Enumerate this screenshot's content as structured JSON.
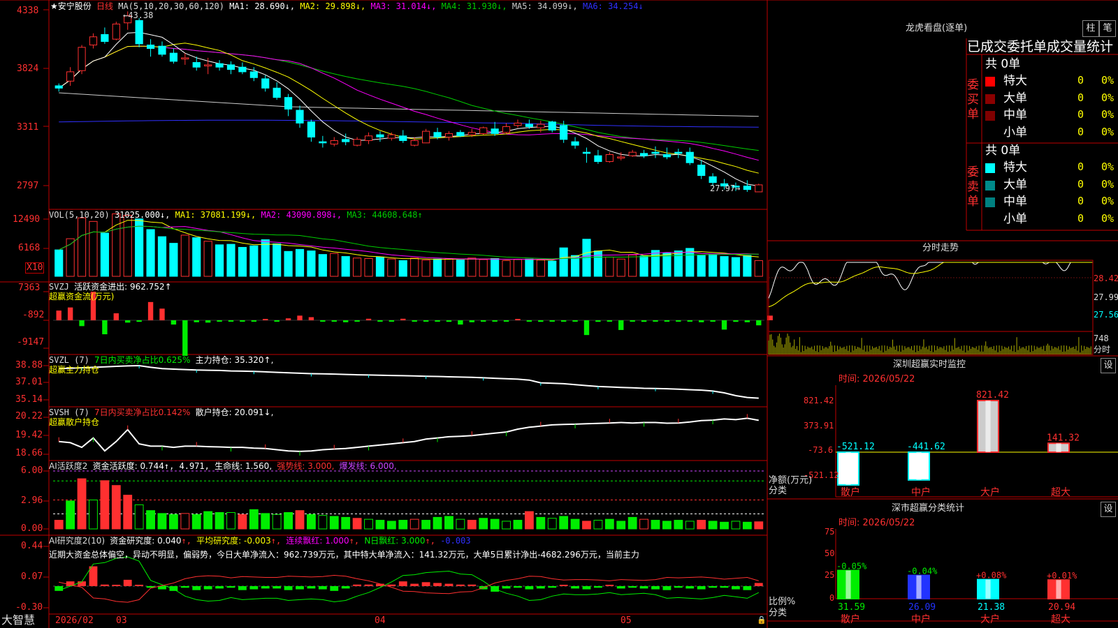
{
  "colors": {
    "up": "#ff3030",
    "down": "#00ffff",
    "frame": "#c00000",
    "axis": "#c00000",
    "ma1": "#ffffff",
    "ma2": "#ffff00",
    "ma3": "#ff00ff",
    "ma4": "#00cc00",
    "ma5": "#cccccc",
    "ma6": "#3030ff",
    "green": "#00ee00",
    "purple": "#cc44ff"
  },
  "price_panel": {
    "stock_name": "★安宁股份",
    "period": "日线",
    "ma_label": "MA(5,10,20,30,60,120)",
    "ma1": "MA1: 28.690↓,",
    "ma2": "MA2: 29.898↓,",
    "ma3": "MA3: 31.014↓,",
    "ma4": "MA4: 31.930↓,",
    "ma5": "MA5: 34.099↓,",
    "ma6": "MA6: 34.254↓",
    "high_marker": "43.38",
    "low_marker": "27.97",
    "y_ticks": [
      "4338",
      "3824",
      "3311",
      "2797"
    ]
  },
  "vol_panel": {
    "label": "VOL(5,10,20)",
    "value": "31025.000↓,",
    "ma1": "MA1: 37081.199↓,",
    "ma2": "MA2: 43090.898↓,",
    "ma3": "MA3: 44608.648↑",
    "y_ticks": [
      "12490",
      "6168"
    ],
    "unit": "X10"
  },
  "svzj_panel": {
    "label": "SVZJ",
    "value": "活跃资金进出: 962.752↑",
    "subtitle": "超赢资金流(万元)",
    "y_ticks": [
      "7363",
      "-892",
      "-9147"
    ]
  },
  "svzl_panel": {
    "label": "SVZL (7)",
    "ratio": "7日内买卖净占比0.625%",
    "hold": "主力持仓: 35.320↑,",
    "subtitle": "超赢主力持仓",
    "y_ticks": [
      "38.88",
      "37.01",
      "35.14"
    ]
  },
  "svsh_panel": {
    "label": "SVSH (7)",
    "ratio": "7日内买卖净占比0.142%",
    "hold": "散户持仓: 20.091↓,",
    "subtitle": "超赢散户持仓",
    "y_ticks": [
      "20.22",
      "19.42",
      "18.66"
    ]
  },
  "ai_act_panel": {
    "label": "AI活跃度2",
    "value": "资金活跃度: 0.744",
    "v2": "↑, 4.971,",
    "life": "生命线: 1.560,",
    "strong": "强势线: 3.000,",
    "burst": "爆发线: 6.000,",
    "y_ticks": [
      "6.00",
      "2.96",
      "0.00"
    ]
  },
  "ai_res_panel": {
    "label": "AI研究度2(10)",
    "value": "资金研究度: 0.040",
    "avg": "平均研究度: -0.003",
    "red": "连续飘红: 1.000",
    "nred": "N日飘红: 3.000",
    "last": "-0.003",
    "comment": "近期大资金总体偏空，异动不明显，偏弱势，今日大单净流入：962.739万元，其中特大单净流入：141.32万元，大单5日累计净出-4682.296万元，当前主力",
    "y_ticks": [
      "0.44",
      "0.07",
      "-0.30"
    ]
  },
  "x_axis": {
    "brand": "大智慧",
    "dates": [
      "2026/02",
      "03",
      "04",
      "05"
    ]
  },
  "right": {
    "dragon_title": "龙虎看盘(逐单)",
    "btn1": "柱",
    "btn2": "笔",
    "orders_title": "已成交委托单成交量统计",
    "buy_label": "委买单",
    "sell_label": "委卖单",
    "buy_total": "共 0单",
    "sell_total": "共 0单",
    "rows": [
      {
        "name": "特大",
        "count": "0",
        "pct": "0%"
      },
      {
        "name": "大单",
        "count": "0",
        "pct": "0%"
      },
      {
        "name": "中单",
        "count": "0",
        "pct": "0%"
      },
      {
        "name": "小单",
        "count": "0",
        "pct": "0%"
      }
    ],
    "buy_colors": [
      "#ff0000",
      "#8b0000",
      "#800000"
    ],
    "sell_colors": [
      "#00ffff",
      "#008b8b",
      "#008080"
    ],
    "minute_title": "分时走势",
    "minute_ticks": [
      "28.42",
      "27.99",
      "27.56"
    ],
    "minute_vol": "748",
    "minute_foot": "分时",
    "sz_title": "深圳超赢实时监控",
    "sz_btn": "设",
    "sz_time": "时间: 2026/05/22",
    "sz_ticks": [
      "821.42",
      "373.91",
      "-73.6",
      "-521.12"
    ],
    "sz_unit": "净额(万元)",
    "sz_cat": "分类",
    "sz_chart": {
      "type": "bar",
      "categories": [
        "散户",
        "中户",
        "大户",
        "超大"
      ],
      "values": [
        -521.12,
        -441.62,
        821.42,
        141.32
      ],
      "labels": [
        "-521.12",
        "-441.62",
        "821.42",
        "141.32"
      ]
    },
    "sm_title": "深市超赢分类统计",
    "sm_btn": "设",
    "sm_time": "时间: 2026/05/22",
    "sm_ticks": [
      "75",
      "50",
      "25",
      "0"
    ],
    "sm_unit": "比例%",
    "sm_cat": "分类",
    "sm_chart": {
      "type": "bar",
      "categories": [
        "散户",
        "中户",
        "大户",
        "超大"
      ],
      "values": [
        31.59,
        26.09,
        21.38,
        20.94
      ],
      "changes": [
        "-0.05%",
        "-0.04%",
        "+0.08%",
        "+0.01%"
      ],
      "labels": [
        "31.59",
        "26.09",
        "21.38",
        "20.94"
      ]
    }
  },
  "chart_data": [
    {
      "type": "candlestick",
      "title": "★安宁股份 日线",
      "ylim": [
        27.0,
        44.0
      ],
      "ohlc": [
        [
          37.0,
          37.2,
          36.5,
          36.8
        ],
        [
          37.4,
          38.6,
          37.0,
          38.2
        ],
        [
          38.3,
          40.5,
          38.0,
          40.3
        ],
        [
          40.5,
          41.5,
          40.2,
          41.2
        ],
        [
          41.4,
          42.0,
          40.6,
          40.8
        ],
        [
          41.0,
          42.5,
          40.9,
          42.3
        ],
        [
          42.4,
          43.38,
          41.8,
          43.0
        ],
        [
          42.6,
          42.8,
          40.3,
          40.6
        ],
        [
          40.5,
          41.0,
          39.5,
          40.2
        ],
        [
          40.4,
          40.8,
          39.5,
          39.7
        ],
        [
          39.8,
          40.2,
          38.9,
          39.1
        ],
        [
          39.3,
          39.8,
          38.8,
          39.4
        ],
        [
          39.0,
          39.5,
          38.3,
          38.6
        ],
        [
          38.7,
          39.4,
          38.0,
          38.8
        ],
        [
          38.9,
          39.2,
          38.3,
          38.6
        ],
        [
          38.8,
          39.1,
          38.0,
          38.4
        ],
        [
          38.6,
          39.0,
          38.0,
          38.2
        ],
        [
          38.2,
          38.6,
          37.4,
          37.7
        ],
        [
          37.6,
          37.9,
          36.5,
          36.8
        ],
        [
          36.8,
          37.3,
          35.8,
          36.0
        ],
        [
          36.0,
          36.3,
          34.4,
          35.0
        ],
        [
          34.9,
          35.3,
          33.4,
          33.8
        ],
        [
          33.9,
          34.1,
          32.2,
          32.6
        ],
        [
          32.2,
          32.7,
          31.7,
          32.1
        ],
        [
          32.0,
          32.6,
          31.8,
          32.3
        ],
        [
          32.4,
          32.9,
          31.9,
          32.2
        ],
        [
          31.9,
          32.6,
          31.8,
          32.4
        ],
        [
          32.3,
          33.0,
          32.0,
          32.7
        ],
        [
          32.8,
          33.1,
          32.2,
          32.6
        ],
        [
          32.5,
          33.0,
          32.3,
          32.8
        ],
        [
          32.7,
          33.2,
          32.1,
          32.3
        ],
        [
          31.9,
          32.6,
          31.8,
          32.3
        ],
        [
          32.1,
          33.3,
          32.1,
          33.1
        ],
        [
          33.0,
          33.4,
          32.4,
          32.6
        ],
        [
          32.6,
          33.1,
          32.3,
          32.9
        ],
        [
          33.0,
          33.2,
          32.6,
          32.7
        ],
        [
          32.8,
          33.3,
          32.6,
          33.0
        ],
        [
          32.9,
          33.5,
          32.8,
          33.4
        ],
        [
          33.3,
          33.9,
          32.7,
          32.9
        ],
        [
          33.0,
          33.8,
          32.9,
          33.5
        ],
        [
          33.6,
          34.1,
          33.4,
          33.8
        ],
        [
          33.7,
          34.1,
          33.3,
          33.5
        ],
        [
          33.4,
          34.0,
          33.0,
          33.7
        ],
        [
          33.9,
          34.0,
          33.0,
          33.2
        ],
        [
          33.6,
          34.0,
          32.1,
          32.4
        ],
        [
          32.2,
          32.6,
          31.6,
          31.9
        ],
        [
          31.3,
          31.7,
          30.4,
          31.2
        ],
        [
          31.0,
          31.5,
          30.3,
          30.5
        ],
        [
          30.5,
          31.3,
          30.4,
          31.1
        ],
        [
          30.8,
          31.3,
          30.6,
          30.9
        ],
        [
          31.0,
          31.5,
          30.9,
          31.3
        ],
        [
          31.2,
          31.5,
          30.8,
          31.0
        ],
        [
          31.3,
          31.8,
          30.8,
          31.2
        ],
        [
          31.1,
          31.7,
          30.7,
          30.9
        ],
        [
          31.3,
          31.6,
          30.8,
          31.2
        ],
        [
          31.3,
          31.7,
          30.2,
          30.4
        ],
        [
          30.2,
          30.6,
          29.0,
          29.3
        ],
        [
          29.2,
          29.5,
          28.4,
          28.7
        ],
        [
          28.6,
          29.0,
          28.1,
          28.4
        ],
        [
          28.4,
          28.7,
          27.97,
          28.3
        ],
        [
          28.4,
          28.9,
          27.9,
          28.1
        ],
        [
          27.9,
          28.6,
          27.97,
          28.5
        ]
      ]
    },
    {
      "type": "bar",
      "title": "VOL(5,10,20)",
      "values": [
        5.2,
        7.4,
        11.5,
        10.8,
        8.5,
        12.3,
        12.0,
        11.3,
        9.2,
        7.8,
        6.5,
        8.1,
        7.6,
        6.9,
        6.2,
        6.3,
        5.7,
        6.0,
        7.2,
        6.4,
        4.9,
        5.3,
        5.0,
        4.3,
        4.5,
        3.9,
        3.6,
        3.5,
        3.8,
        3.4,
        3.1,
        3.6,
        3.2,
        3.4,
        3.5,
        3.2,
        3.6,
        3.3,
        3.5,
        3.1,
        3.3,
        3.4,
        3.2,
        3.0,
        5.6,
        4.1,
        7.3,
        5.0,
        3.8,
        3.4,
        4.2,
        4.0,
        5.1,
        4.6,
        5.0,
        5.5,
        4.1,
        4.3,
        3.9,
        3.7,
        4.1,
        3.1
      ]
    },
    {
      "type": "bar",
      "title": "超赢资金流(万元)",
      "values": [
        2.5,
        3.3,
        -1.5,
        7.36,
        -3.6,
        1.8,
        -0.6,
        -0.4,
        4.7,
        3.0,
        -1.1,
        -9.15,
        -0.5,
        -0.6,
        -0.3,
        -0.3,
        -0.2,
        -0.2,
        0.2,
        -0.3,
        0.5,
        1.2,
        0.8,
        -0.2,
        -0.3,
        -0.5,
        -0.2,
        0.4,
        -0.3,
        -0.3,
        0.4,
        -0.3,
        -0.2,
        -0.2,
        -0.4,
        -1.1,
        -0.5,
        -0.3,
        -0.2,
        -0.3,
        0.3,
        -0.3,
        -0.4,
        -0.2,
        -0.3,
        -0.3,
        -3.8,
        -0.4,
        -0.3,
        -2.5,
        -0.3,
        -0.4,
        -0.3,
        -0.3,
        -0.3,
        -0.3,
        -0.5,
        -0.3,
        -2.4,
        -0.4,
        -0.5,
        -1.3,
        1.2
      ]
    },
    {
      "type": "line",
      "title": "超赢主力持仓",
      "values": [
        38.55,
        38.6,
        38.65,
        38.7,
        38.75,
        38.8,
        38.85,
        38.88,
        38.7,
        38.55,
        38.5,
        38.45,
        38.4,
        38.38,
        38.35,
        38.3,
        38.28,
        38.25,
        38.2,
        38.15,
        38.1,
        38.05,
        38.0,
        37.98,
        37.96,
        37.92,
        37.88,
        37.86,
        37.83,
        37.8,
        37.78,
        37.75,
        37.72,
        37.7,
        37.66,
        37.63,
        37.6,
        37.55,
        37.5,
        37.45,
        37.4,
        37.3,
        37.0,
        36.95,
        36.9,
        36.8,
        36.7,
        36.6,
        36.55,
        36.5,
        36.45,
        36.4,
        36.38,
        36.35,
        36.3,
        36.25,
        36.2,
        36.1,
        35.9,
        35.6,
        35.4,
        35.32
      ]
    },
    {
      "type": "line",
      "title": "超赢散户持仓",
      "values": [
        19.2,
        19.15,
        18.95,
        19.35,
        18.8,
        19.2,
        19.7,
        19.1,
        19.0,
        19.0,
        18.95,
        19.0,
        19.0,
        18.98,
        18.97,
        18.95,
        18.95,
        18.92,
        18.9,
        18.85,
        18.8,
        18.78,
        18.8,
        18.85,
        18.88,
        18.9,
        18.95,
        19.0,
        19.05,
        19.1,
        19.15,
        19.2,
        19.3,
        19.35,
        19.4,
        19.42,
        19.45,
        19.5,
        19.55,
        19.6,
        19.72,
        19.8,
        19.85,
        19.9,
        19.92,
        19.93,
        19.95,
        19.96,
        19.98,
        20.0,
        19.98,
        20.0,
        20.0,
        19.97,
        19.98,
        20.02,
        20.08,
        20.1,
        20.15,
        20.12,
        20.18,
        20.09
      ]
    },
    {
      "type": "bar",
      "title": "AI活跃度2",
      "values": [
        0.9,
        2.9,
        5.2,
        3.0,
        5.0,
        4.5,
        3.5,
        2.5,
        1.9,
        1.6,
        1.5,
        1.6,
        1.5,
        1.8,
        1.7,
        1.7,
        1.5,
        2.0,
        1.6,
        1.5,
        1.7,
        1.9,
        1.5,
        1.4,
        1.3,
        1.2,
        1.1,
        1.0,
        0.9,
        0.8,
        0.9,
        1.0,
        0.9,
        1.2,
        1.3,
        1.0,
        0.9,
        1.1,
        1.0,
        0.8,
        0.9,
        1.8,
        1.2,
        1.1,
        1.3,
        1.0,
        0.8,
        0.9,
        1.0,
        0.8,
        1.2,
        1.0,
        0.9,
        0.8,
        0.9,
        0.8,
        0.9,
        0.8,
        0.7,
        0.8,
        0.7,
        0.74
      ]
    },
    {
      "type": "bar",
      "title": "AI研究度2(10)",
      "values": [
        -0.06,
        0.06,
        0.06,
        0.25,
        0.02,
        0.0,
        0.08,
        0.0,
        -0.02,
        -0.04,
        -0.06,
        -0.02,
        -0.05,
        -0.04,
        -0.03,
        -0.02,
        -0.05,
        -0.04,
        -0.03,
        -0.03,
        -0.05,
        -0.04,
        -0.03,
        -0.04,
        -0.06,
        -0.03,
        0.02,
        0.02,
        0.03,
        0.02,
        0.06,
        0.03,
        0.05,
        0.04,
        0.03,
        0.02,
        0.02,
        -0.04,
        -0.07,
        -0.03,
        -0.02,
        -0.04,
        -0.03,
        -0.02,
        0.0,
        -0.03,
        -0.04,
        -0.02,
        0.0,
        -0.03,
        -0.02,
        -0.03,
        -0.04,
        -0.05,
        -0.02,
        -0.03,
        -0.04,
        -0.02,
        -0.02,
        -0.04,
        -0.05,
        0.04
      ]
    }
  ]
}
